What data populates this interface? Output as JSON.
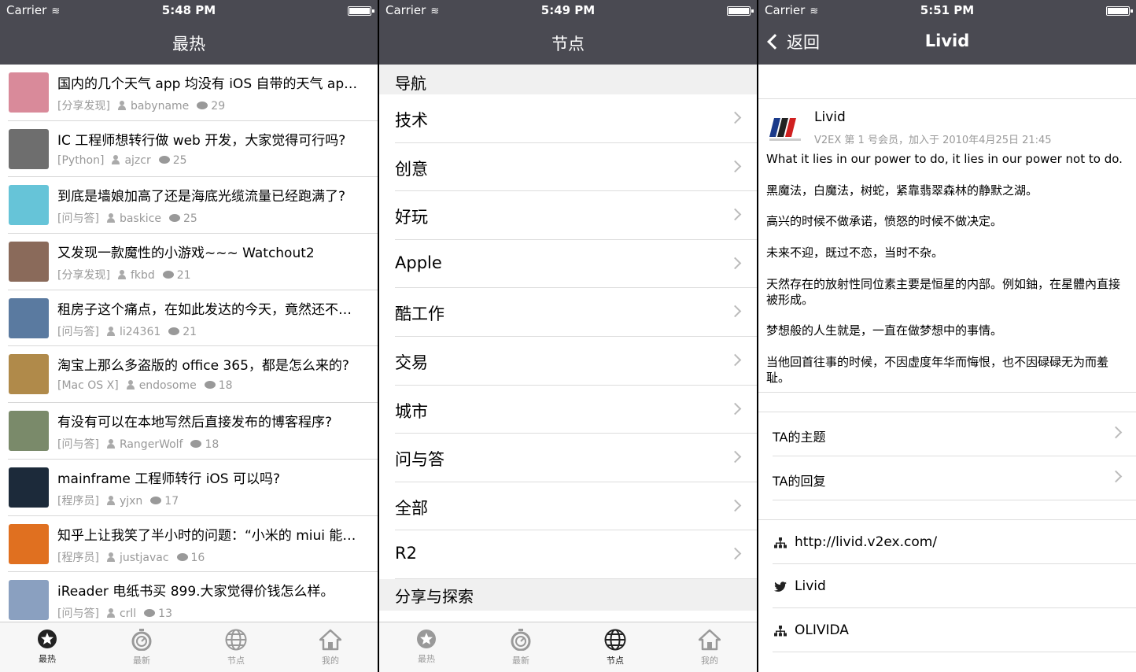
{
  "status": {
    "carrier": "Carrier",
    "times": [
      "5:48 PM",
      "5:49 PM",
      "5:51 PM"
    ]
  },
  "colors": {
    "navbar": "#4a4a52",
    "meta_text": "#999999",
    "tab_active": "#222222"
  },
  "tabs": [
    {
      "label": "最热",
      "icon": "star-icon"
    },
    {
      "label": "最新",
      "icon": "stopwatch-icon"
    },
    {
      "label": "节点",
      "icon": "globe-icon"
    },
    {
      "label": "我的",
      "icon": "home-icon"
    }
  ],
  "hot": {
    "title": "最热",
    "items": [
      {
        "title": "国内的几个天气 app 均没有 iOS 自带的天气 ap…",
        "node": "[分享发现]",
        "user": "babyname",
        "replies": "29",
        "color": "#d98a9a"
      },
      {
        "title": "IC 工程师想转行做 web 开发，大家觉得可行吗?",
        "node": "[Python]",
        "user": "ajzcr",
        "replies": "25",
        "color": "#6e6e6e"
      },
      {
        "title": "到底是墙娘加高了还是海底光缆流量已经跑满了?",
        "node": "[问与答]",
        "user": "baskice",
        "replies": "25",
        "color": "#66c4d8"
      },
      {
        "title": "又发现一款魔性的小游戏~~~ Watchout2",
        "node": "[分享发现]",
        "user": "fkbd",
        "replies": "21",
        "color": "#8a6a5a"
      },
      {
        "title": "租房子这个痛点，在如此发达的今天，竟然还不…",
        "node": "[问与答]",
        "user": "li24361",
        "replies": "21",
        "color": "#5a7aa0"
      },
      {
        "title": "淘宝上那么多盗版的 office 365，都是怎么来的?",
        "node": "[Mac OS X]",
        "user": "endosome",
        "replies": "18",
        "color": "#b08a4a"
      },
      {
        "title": "有没有可以在本地写然后直接发布的博客程序?",
        "node": "[问与答]",
        "user": "RangerWolf",
        "replies": "18",
        "color": "#7a8a6a"
      },
      {
        "title": "mainframe 工程师转行 iOS 可以吗?",
        "node": "[程序员]",
        "user": "yjxn",
        "replies": "17",
        "color": "#1c2a3a"
      },
      {
        "title": "知乎上让我笑了半小时的问题：“小米的 miui 能…",
        "node": "[程序员]",
        "user": "justjavac",
        "replies": "16",
        "color": "#e07020"
      },
      {
        "title": "iReader 电纸书买 899.大家觉得价钱怎么样。",
        "node": "[问与答]",
        "user": "crll",
        "replies": "13",
        "color": "#8aa0c0"
      }
    ]
  },
  "nodes": {
    "title": "节点",
    "section1": "导航",
    "items": [
      "技术",
      "创意",
      "好玩",
      "Apple",
      "酷工作",
      "交易",
      "城市",
      "问与答",
      "全部",
      "R2"
    ],
    "section2": "分享与探索"
  },
  "profile": {
    "back": "返回",
    "title": "Livid",
    "name": "Livid",
    "meta": "V2EX 第 1 号会员，加入于 2010年4月25日 21:45",
    "bio": [
      "What it lies in our power to do, it lies in our power not to do.",
      "黑魔法，白魔法，树蛇，紧靠翡翠森林的静默之湖。",
      "高兴的时候不做承诺，愤怒的时候不做决定。",
      "未来不迎，既过不恋，当时不杂。",
      "天然存在的放射性同位素主要是恒星的内部。例如鈾，在星體內直接被形成。",
      "梦想般的人生就是，一直在做梦想中的事情。",
      "当他回首往事的时候，不因虚度年华而悔恨，也不因碌碌无为而羞耻。"
    ],
    "topics_label": "TA的主题",
    "replies_label": "TA的回复",
    "links": [
      {
        "label": "http://livid.v2ex.com/",
        "icon": "sitemap-icon"
      },
      {
        "label": "Livid",
        "icon": "twitter-icon"
      },
      {
        "label": "OLIVIDA",
        "icon": "sitemap-icon"
      }
    ]
  }
}
